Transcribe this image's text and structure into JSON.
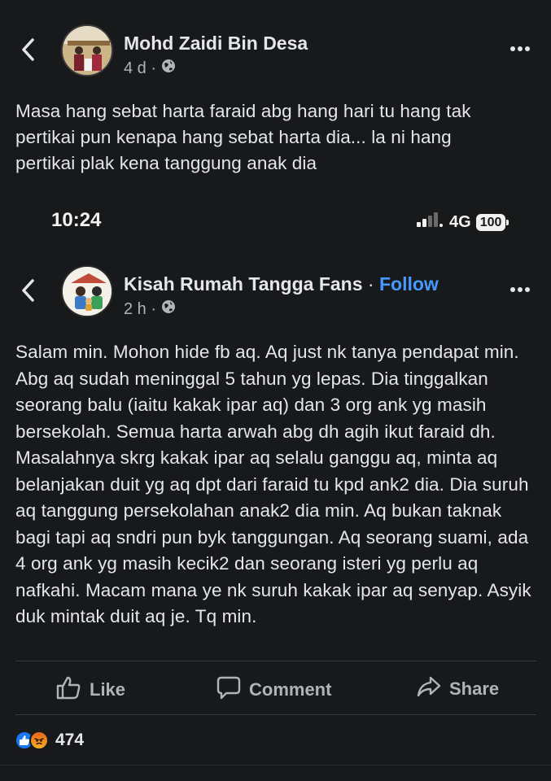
{
  "post": {
    "author": "Mohd Zaidi Bin Desa",
    "time": "4 d ·",
    "text": "Masa hang sebat harta faraid abg hang hari tu hang tak pertikai pun kenapa hang sebat harta dia... la ni hang pertikai plak kena tanggung anak dia"
  },
  "embedded": {
    "status_bar": {
      "time": "10:24",
      "network": "4G",
      "battery": "100"
    },
    "page_name": "Kisah Rumah Tangga Fans",
    "separator": " · ",
    "follow_label": "Follow",
    "time": "2 h ·",
    "text": "Salam min. Mohon hide fb aq. Aq just nk tanya pendapat min. Abg aq sudah meninggal 5 tahun yg lepas. Dia tinggalkan seorang balu (iaitu kakak ipar aq) dan 3 org ank yg masih bersekolah. Semua harta arwah abg dh agih ikut faraid dh. Masalahnya skrg kakak ipar aq selalu ganggu aq, minta aq belanjakan duit yg aq dpt dari faraid tu kpd ank2 dia. Dia suruh aq tanggung persekolahan anak2 dia min. Aq bukan taknak bagi tapi aq sndri pun byk tanggungan. Aq seorang suami, ada 4 org ank yg masih kecik2 dan seorang isteri yg perlu aq nafkahi. Macam mana ye nk suruh kakak ipar aq senyap. Asyik duk mintak duit aq je. Tq min."
  },
  "actions": {
    "like": "Like",
    "comment": "Comment",
    "share": "Share"
  },
  "reactions": {
    "count": "474",
    "types": [
      "like",
      "angry"
    ]
  },
  "colors": {
    "background": "#18191a",
    "text": "#e4e6eb",
    "secondary": "#b0b3b8",
    "link": "#4599ff"
  },
  "icons": [
    "back-icon",
    "more-icon",
    "globe-icon",
    "signal-icon",
    "like-icon",
    "comment-icon",
    "share-icon"
  ]
}
